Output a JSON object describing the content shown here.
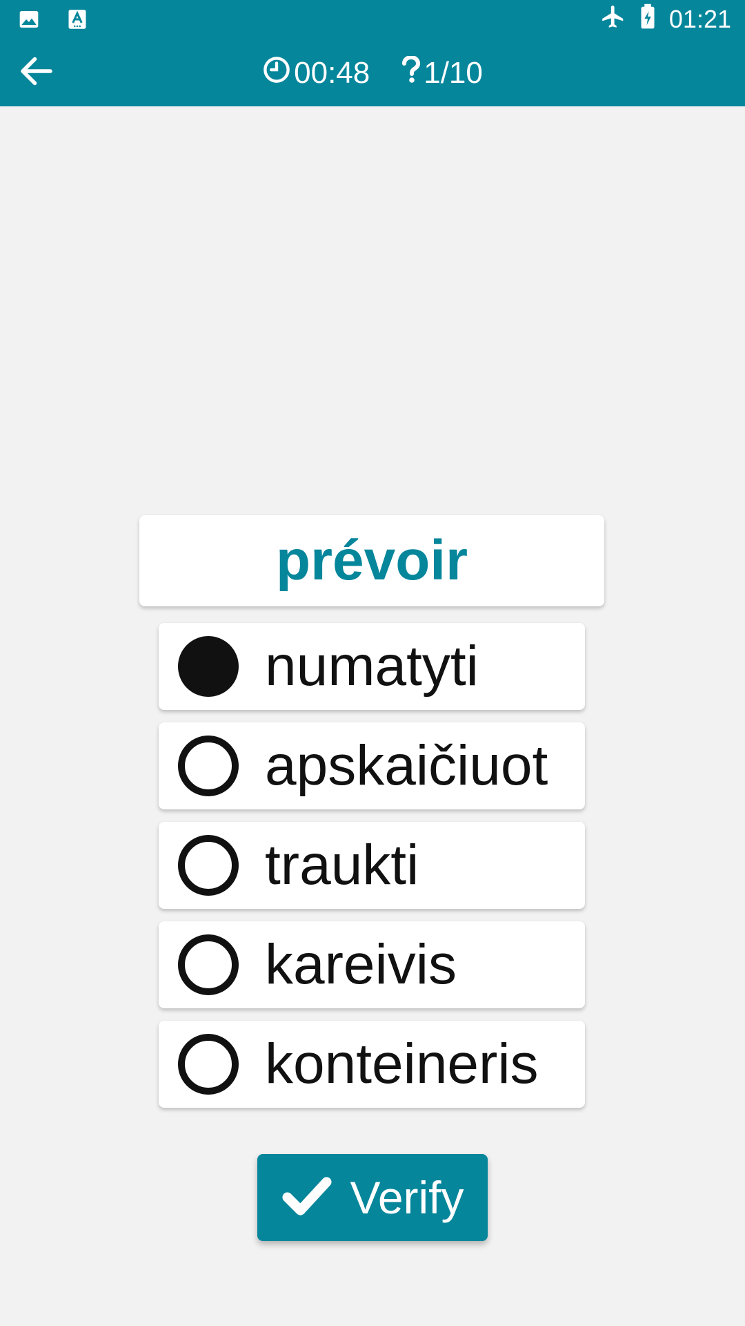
{
  "status_bar": {
    "left_icons": [
      "image-icon",
      "text-app-icon"
    ],
    "right_icons": [
      "airplane-icon",
      "battery-charging-icon"
    ],
    "time": "01:21"
  },
  "toolbar": {
    "back_icon": "arrow-back-icon",
    "timer_icon": "clock-icon",
    "timer": "00:48",
    "question_icon": "question-icon",
    "progress": "1/10"
  },
  "quiz": {
    "word": "prévoir",
    "options": [
      {
        "label": "numatyti",
        "selected": true
      },
      {
        "label": "apskaičiuot",
        "selected": false
      },
      {
        "label": "traukti",
        "selected": false
      },
      {
        "label": "kareivis",
        "selected": false
      },
      {
        "label": "konteineris",
        "selected": false
      }
    ]
  },
  "actions": {
    "verify_label": "Verify",
    "verify_icon": "checkmark-icon"
  },
  "colors": {
    "accent": "#06869b",
    "background": "#f2f2f2",
    "card": "#ffffff",
    "text": "#111111"
  }
}
